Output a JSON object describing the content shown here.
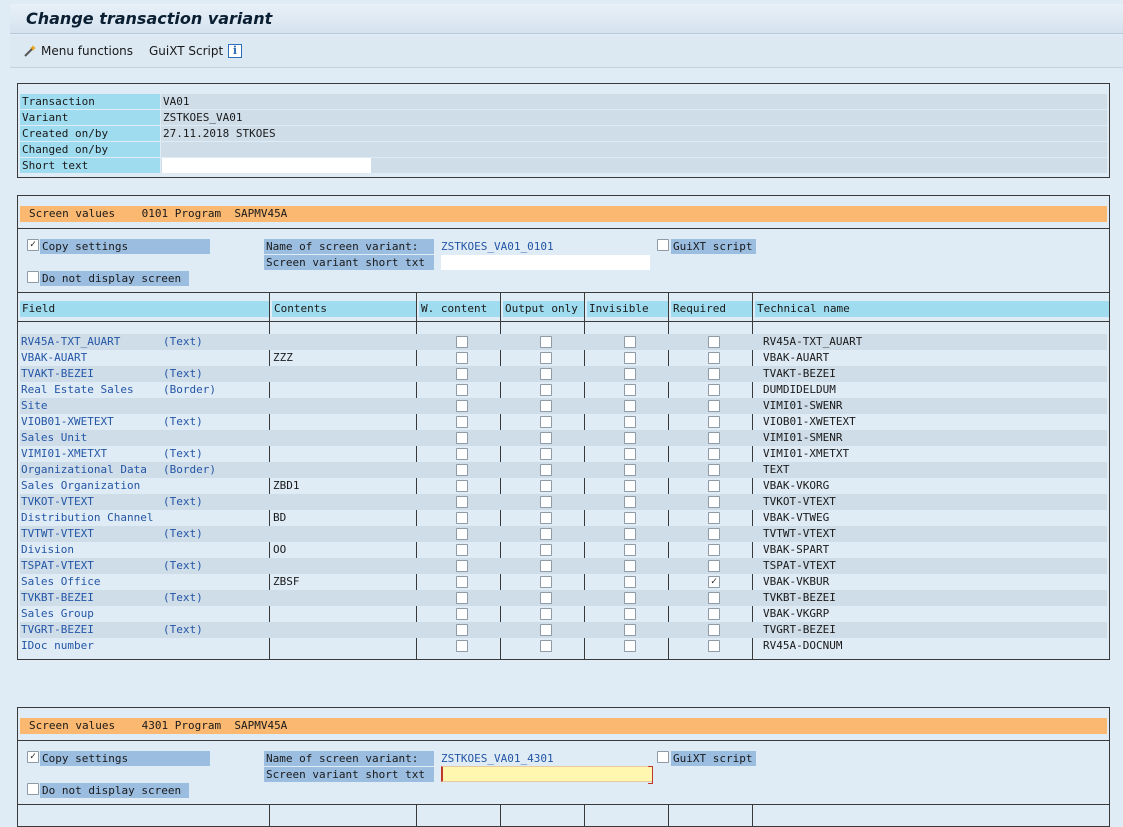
{
  "window": {
    "title": "Change transaction variant"
  },
  "toolbar": {
    "menu_functions": "Menu functions",
    "guixt_script": "GuiXT Script",
    "info_symbol": "i"
  },
  "header": {
    "rows": [
      {
        "label": "Transaction",
        "value": "VA01"
      },
      {
        "label": "Variant",
        "value": "ZSTKOES_VA01"
      },
      {
        "label": "Created on/by",
        "value": "27.11.2018 STKOES"
      },
      {
        "label": "Changed on/by",
        "value": ""
      },
      {
        "label": "Short text",
        "value": ""
      }
    ]
  },
  "screen1": {
    "bar": {
      "label": "Screen values",
      "number": "0101",
      "program_label": "Program",
      "program": "SAPMV45A"
    },
    "copy_settings": "Copy settings",
    "do_not_display": "Do not display screen",
    "name_label": "Name of screen variant:",
    "name_value": "ZSTKOES_VA01_0101",
    "short_txt_label": "Screen variant short txt",
    "short_txt_value": "",
    "guixt_label": "GuiXT script",
    "columns": [
      "Field",
      "Contents",
      "W. content",
      "Output only",
      "Invisible",
      "Required",
      "Technical name"
    ],
    "rows": [
      {
        "field": "RV45A-TXT_AUART",
        "type": "(Text)",
        "contents": "",
        "required": false,
        "tech": "RV45A-TXT_AUART"
      },
      {
        "field": "VBAK-AUART",
        "type": "",
        "contents": "ZZZ",
        "required": false,
        "tech": "VBAK-AUART"
      },
      {
        "field": "TVAKT-BEZEI",
        "type": "(Text)",
        "contents": "",
        "required": false,
        "tech": "TVAKT-BEZEI"
      },
      {
        "field": "Real Estate Sales",
        "type": "(Border)",
        "contents": "",
        "required": false,
        "tech": "DUMDIDELDUM"
      },
      {
        "field": "Site",
        "type": "",
        "contents": "",
        "required": false,
        "tech": "VIMI01-SWENR"
      },
      {
        "field": "VIOB01-XWETEXT",
        "type": "(Text)",
        "contents": "",
        "required": false,
        "tech": "VIOB01-XWETEXT"
      },
      {
        "field": "Sales Unit",
        "type": "",
        "contents": "",
        "required": false,
        "tech": "VIMI01-SMENR"
      },
      {
        "field": "VIMI01-XMETXT",
        "type": "(Text)",
        "contents": "",
        "required": false,
        "tech": "VIMI01-XMETXT"
      },
      {
        "field": "Organizational Data",
        "type": "(Border)",
        "contents": "",
        "required": false,
        "tech": "TEXT"
      },
      {
        "field": "Sales Organization",
        "type": "",
        "contents": "ZBD1",
        "required": false,
        "tech": "VBAK-VKORG"
      },
      {
        "field": "TVKOT-VTEXT",
        "type": "(Text)",
        "contents": "",
        "required": false,
        "tech": "TVKOT-VTEXT"
      },
      {
        "field": "Distribution Channel",
        "type": "",
        "contents": "BD",
        "required": false,
        "tech": "VBAK-VTWEG"
      },
      {
        "field": "TVTWT-VTEXT",
        "type": "(Text)",
        "contents": "",
        "required": false,
        "tech": "TVTWT-VTEXT"
      },
      {
        "field": "Division",
        "type": "",
        "contents": "OO",
        "required": false,
        "tech": "VBAK-SPART"
      },
      {
        "field": "TSPAT-VTEXT",
        "type": "(Text)",
        "contents": "",
        "required": false,
        "tech": "TSPAT-VTEXT"
      },
      {
        "field": "Sales Office",
        "type": "",
        "contents": "ZBSF",
        "required": true,
        "tech": "VBAK-VKBUR"
      },
      {
        "field": "TVKBT-BEZEI",
        "type": "(Text)",
        "contents": "",
        "required": false,
        "tech": "TVKBT-BEZEI"
      },
      {
        "field": "Sales Group",
        "type": "",
        "contents": "",
        "required": false,
        "tech": "VBAK-VKGRP"
      },
      {
        "field": "TVGRT-BEZEI",
        "type": "(Text)",
        "contents": "",
        "required": false,
        "tech": "TVGRT-BEZEI"
      },
      {
        "field": "IDoc number",
        "type": "",
        "contents": "",
        "required": false,
        "tech": "RV45A-DOCNUM"
      }
    ]
  },
  "screen2": {
    "bar": {
      "label": "Screen values",
      "number": "4301",
      "program_label": "Program",
      "program": "SAPMV45A"
    },
    "copy_settings": "Copy settings",
    "do_not_display": "Do not display screen",
    "name_label": "Name of screen variant:",
    "name_value": "ZSTKOES_VA01_4301",
    "short_txt_label": "Screen variant short txt",
    "short_txt_value": "",
    "guixt_label": "GuiXT script"
  },
  "checkmark": "✓"
}
